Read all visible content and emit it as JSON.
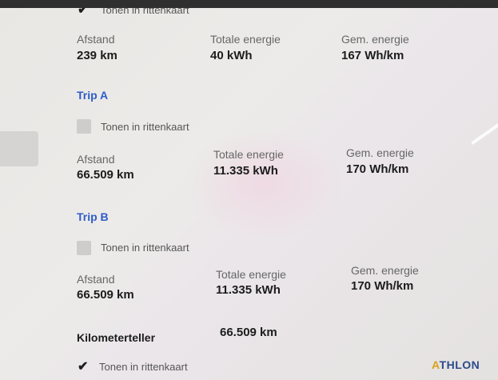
{
  "top": {
    "checkbox_label": "Tonen in rittenkaart",
    "checked": true,
    "distance_label": "Afstand",
    "distance_value": "239 km",
    "energy_label": "Totale energie",
    "energy_value": "40 kWh",
    "avg_label": "Gem. energie",
    "avg_value": "167 Wh/km"
  },
  "trip_a": {
    "title": "Trip A",
    "checkbox_label": "Tonen in rittenkaart",
    "checked": false,
    "distance_label": "Afstand",
    "distance_value": "66.509 km",
    "energy_label": "Totale energie",
    "energy_value": "11.335 kWh",
    "avg_label": "Gem. energie",
    "avg_value": "170 Wh/km"
  },
  "trip_b": {
    "title": "Trip B",
    "checkbox_label": "Tonen in rittenkaart",
    "checked": false,
    "distance_label": "Afstand",
    "distance_value": "66.509 km",
    "energy_label": "Totale energie",
    "energy_value": "11.335 kWh",
    "avg_label": "Gem. energie",
    "avg_value": "170 Wh/km"
  },
  "odometer": {
    "label": "Kilometerteller",
    "value": "66.509 km",
    "checkbox_label": "Tonen in rittenkaart",
    "checked": true
  },
  "brand": {
    "logo_text": "THLON",
    "logo_mark": "A"
  }
}
